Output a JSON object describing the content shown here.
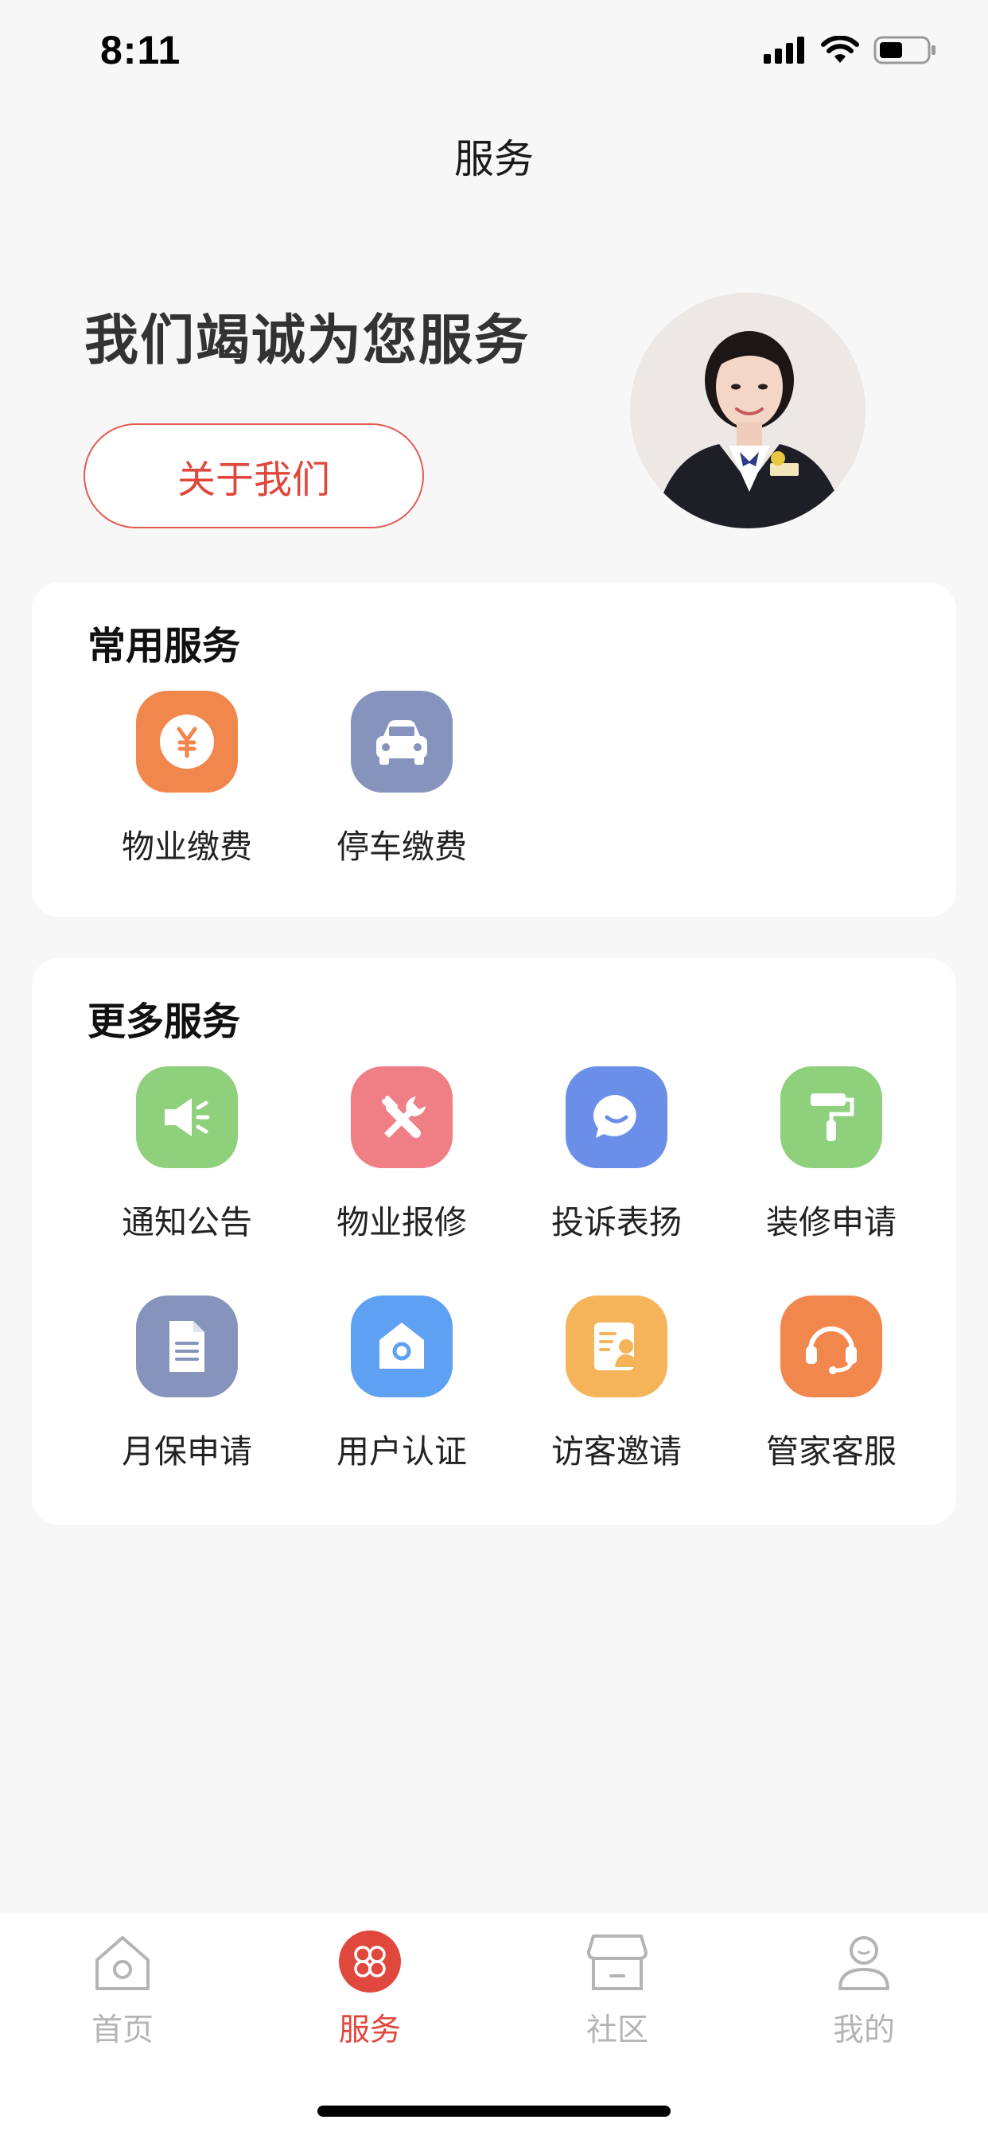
{
  "status_bar": {
    "time": "8:11",
    "icons": [
      "signal-icon",
      "wifi-icon",
      "battery-icon"
    ]
  },
  "nav": {
    "title": "服务"
  },
  "hero": {
    "heading": "我们竭诚为您服务",
    "about_button": "关于我们",
    "avatar_description": "customer-service-avatar"
  },
  "common_services": {
    "title": "常用服务",
    "items": [
      {
        "label": "物业缴费",
        "icon": "yuan-coin-icon",
        "color": "#f2874e"
      },
      {
        "label": "停车缴费",
        "icon": "car-icon",
        "color": "#8694bd"
      }
    ]
  },
  "more_services": {
    "title": "更多服务",
    "items": [
      {
        "label": "通知公告",
        "icon": "megaphone-icon",
        "color": "#8fd07c"
      },
      {
        "label": "物业报修",
        "icon": "wrench-screwdriver-icon",
        "color": "#ef7f85"
      },
      {
        "label": "投诉表扬",
        "icon": "chat-bubble-icon",
        "color": "#6b8fe8"
      },
      {
        "label": "装修申请",
        "icon": "paint-roller-icon",
        "color": "#8fd07c"
      },
      {
        "label": "月保申请",
        "icon": "document-icon",
        "color": "#8694bd"
      },
      {
        "label": "用户认证",
        "icon": "house-shield-icon",
        "color": "#5ea0f2"
      },
      {
        "label": "访客邀请",
        "icon": "visitor-card-icon",
        "color": "#f5b45a"
      },
      {
        "label": "管家客服",
        "icon": "headset-icon",
        "color": "#f2874e"
      }
    ]
  },
  "tab_bar": {
    "accent_color": "#e0473d",
    "items": [
      {
        "label": "首页",
        "icon": "home-icon",
        "active": false
      },
      {
        "label": "服务",
        "icon": "services-icon",
        "active": true
      },
      {
        "label": "社区",
        "icon": "shop-icon",
        "active": false
      },
      {
        "label": "我的",
        "icon": "profile-icon",
        "active": false
      }
    ]
  }
}
